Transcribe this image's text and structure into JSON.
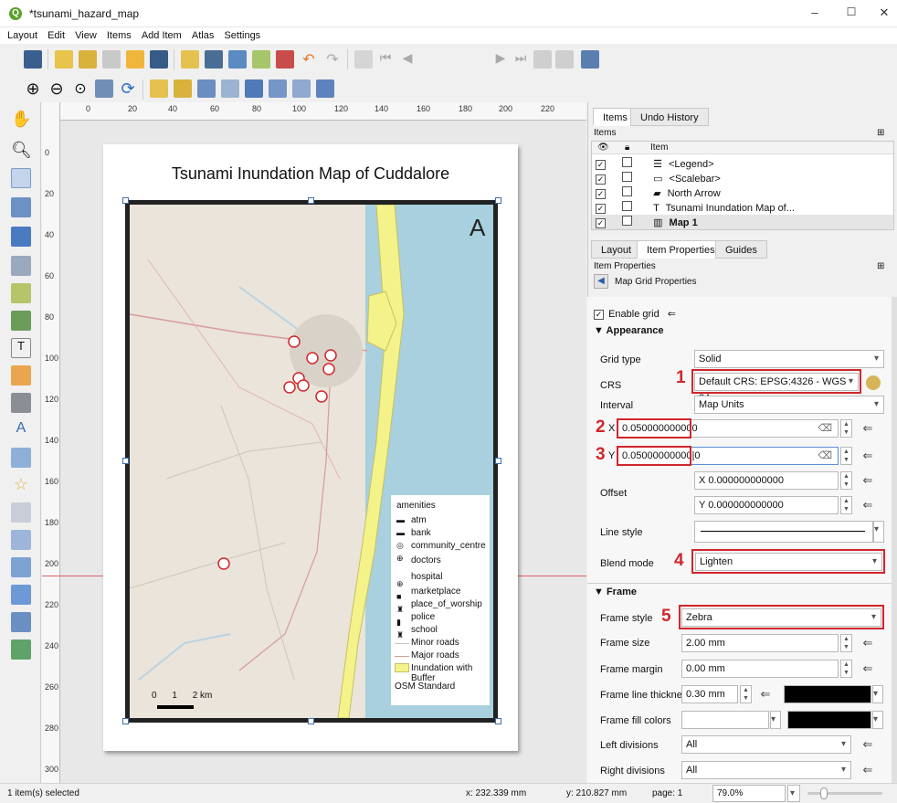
{
  "window": {
    "title": "*tsunami_hazard_map",
    "minimize": "–",
    "maximize": "☐",
    "close": "✕"
  },
  "menu": [
    "Layout",
    "Edit",
    "View",
    "Items",
    "Add Item",
    "Atlas",
    "Settings"
  ],
  "toolbar": {
    "page_input": "1"
  },
  "canvas": {
    "ruler_h": [
      "0",
      "20",
      "40",
      "60",
      "80",
      "100",
      "120",
      "140",
      "160",
      "180",
      "200",
      "220"
    ],
    "ruler_v": [
      "0",
      "20",
      "40",
      "60",
      "80",
      "100",
      "120",
      "140",
      "160",
      "180",
      "200",
      "220",
      "240",
      "260",
      "280",
      "300"
    ],
    "map_title": "Tsunami Inundation Map of Cuddalore",
    "legend": {
      "heading": "amenities",
      "items": [
        "atm",
        "bank",
        "community_centre",
        "doctors",
        "hospital",
        "marketplace",
        "place_of_worship",
        "police",
        "school",
        "Minor roads",
        "Major roads",
        "Inundation with Buffer",
        "OSM Standard"
      ]
    },
    "scalebar": {
      "labels": [
        "0",
        "1",
        "2 km"
      ]
    }
  },
  "panel": {
    "tabs_top": [
      "Items",
      "Undo History"
    ],
    "items_header": "Items",
    "items_col": "Item",
    "items": [
      "<Legend>",
      "<Scalebar>",
      "North Arrow",
      "Tsunami Inundation Map of...",
      "Map 1"
    ],
    "tabs_mid": [
      "Layout",
      "Item Properties",
      "Guides"
    ],
    "item_props_header": "Item Properties",
    "grid_props": "Map Grid Properties",
    "enable_grid": "Enable grid",
    "appearance": "Appearance",
    "grid_type_label": "Grid type",
    "grid_type": "Solid",
    "crs_label": "CRS",
    "crs": "Default CRS: EPSG:4326 - WGS 84",
    "interval_label": "Interval",
    "interval": "Map Units",
    "x_label": "X",
    "x_value": "0.050000000000",
    "y_label": "Y",
    "y_value": "0.05000000000|0",
    "offset_label": "Offset",
    "offset_x": "X 0.000000000000",
    "offset_y": "Y 0.000000000000",
    "line_style_label": "Line style",
    "blend_label": "Blend mode",
    "blend": "Lighten",
    "frame": "Frame",
    "frame_style_label": "Frame style",
    "frame_style": "Zebra",
    "frame_size_label": "Frame size",
    "frame_size": "2.00 mm",
    "frame_margin_label": "Frame margin",
    "frame_margin": "0.00 mm",
    "frame_line_label": "Frame line thickness",
    "frame_line": "0.30 mm",
    "frame_fill_label": "Frame fill colors",
    "left_div_label": "Left divisions",
    "left_div": "All",
    "right_div_label": "Right divisions",
    "right_div": "All",
    "annotations": [
      "1",
      "2",
      "3",
      "4",
      "5"
    ]
  },
  "status": {
    "selected": "1 item(s) selected",
    "x": "x: 232.339 mm",
    "y": "y: 210.827 mm",
    "page": "page: 1",
    "zoom": "79.0%"
  },
  "colors": {
    "accent_red": "#d0262c",
    "sea": "#a8d0de",
    "inundation": "#f4f38a"
  }
}
